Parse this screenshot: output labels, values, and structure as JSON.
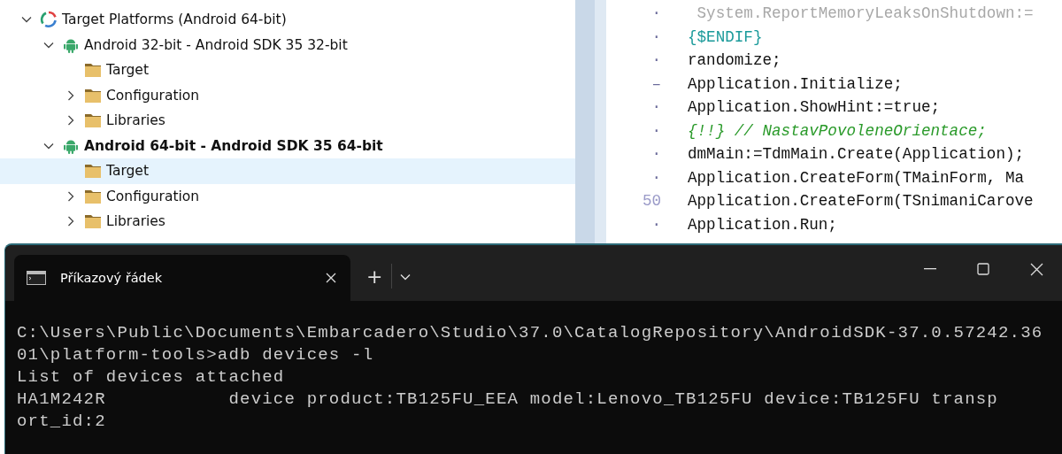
{
  "project_tree": {
    "items": [
      {
        "label": "Target Platforms (Android 64-bit)",
        "kind": "platforms",
        "expanded": true,
        "selected": false,
        "active": false,
        "children": [
          {
            "label": "Android 32-bit - Android SDK 35 32-bit",
            "kind": "android",
            "expanded": true,
            "selected": false,
            "active": false,
            "children": [
              {
                "label": "Target",
                "kind": "folder",
                "selected": false,
                "active": false
              },
              {
                "label": "Configuration",
                "kind": "folder",
                "expanded": false,
                "selected": false,
                "active": false
              },
              {
                "label": "Libraries",
                "kind": "folder",
                "expanded": false,
                "selected": false,
                "active": false
              }
            ]
          },
          {
            "label": "Android 64-bit - Android SDK 35 64-bit",
            "kind": "android",
            "expanded": true,
            "selected": false,
            "active": true,
            "children": [
              {
                "label": "Target",
                "kind": "folder",
                "selected": true,
                "active": false
              },
              {
                "label": "Configuration",
                "kind": "folder",
                "expanded": false,
                "selected": false,
                "active": false
              },
              {
                "label": "Libraries",
                "kind": "folder",
                "expanded": false,
                "selected": false,
                "active": false
              }
            ]
          }
        ]
      }
    ]
  },
  "code_editor": {
    "lines": [
      {
        "gutter": "·",
        "text": " System.ReportMemoryLeaksOnShutdown:=",
        "kind": "inactive"
      },
      {
        "gutter": "·",
        "text": "{$ENDIF}",
        "kind": "directive"
      },
      {
        "gutter": "·",
        "text": "randomize;",
        "kind": "code"
      },
      {
        "gutter": "–",
        "text": "Application.Initialize;",
        "kind": "code"
      },
      {
        "gutter": "·",
        "text": "Application.ShowHint:=true;",
        "kind": "code"
      },
      {
        "gutter": "·",
        "text": "{!!} // NastavPovoleneOrientace;",
        "kind": "comment"
      },
      {
        "gutter": "·",
        "text": "dmMain:=TdmMain.Create(Application);",
        "kind": "code"
      },
      {
        "gutter": "·",
        "text": "Application.CreateForm(TMainForm, Ma",
        "kind": "code"
      },
      {
        "gutter": "50",
        "text": "Application.CreateForm(TSnimaniCarove",
        "kind": "code"
      },
      {
        "gutter": "·",
        "text": "Application.Run;",
        "kind": "code"
      }
    ]
  },
  "terminal": {
    "tab_title": "Příkazový řádek",
    "new_tab": "+",
    "lines": [
      "C:\\Users\\Public\\Documents\\Embarcadero\\Studio\\37.0\\CatalogRepository\\AndroidSDK-37.0.57242.36",
      "01\\platform-tools>adb devices -l",
      "List of devices attached",
      "HA1M242R           device product:TB125FU_EEA model:Lenovo_TB125FU device:TB125FU transp",
      "ort_id:2"
    ]
  }
}
